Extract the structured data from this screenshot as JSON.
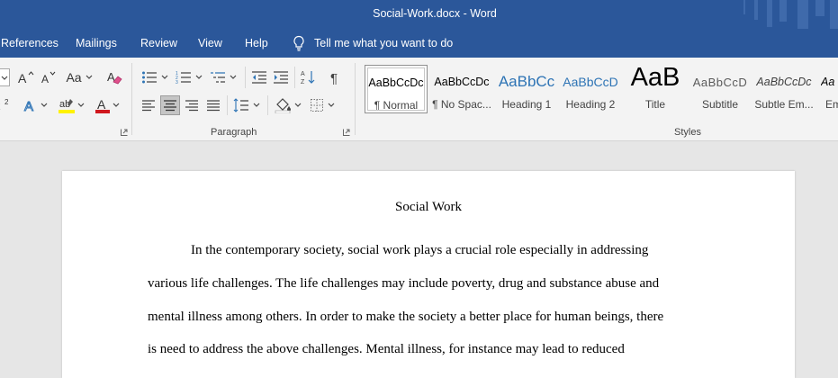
{
  "window": {
    "title": "Social-Work.docx  -  Word"
  },
  "menu": {
    "tabs": [
      "References",
      "Mailings",
      "Review",
      "View",
      "Help"
    ],
    "tell_me": "Tell me what you want to do"
  },
  "ribbon": {
    "font": {
      "change_case_label": "Aa"
    },
    "groups": {
      "paragraph_label": "Paragraph",
      "styles_label": "Styles"
    },
    "styles": [
      {
        "preview": "AaBbCcDc",
        "name": "¶ Normal",
        "selected": true
      },
      {
        "preview": "AaBbCcDc",
        "name": "¶ No Spac...",
        "selected": false
      },
      {
        "preview": "AaBbCc",
        "name": "Heading 1",
        "selected": false
      },
      {
        "preview": "AaBbCcD",
        "name": "Heading 2",
        "selected": false
      },
      {
        "preview": "AaB",
        "name": "Title",
        "selected": false
      },
      {
        "preview": "AaBbCcD",
        "name": "Subtitle",
        "selected": false
      },
      {
        "preview": "AaBbCcDc",
        "name": "Subtle Em...",
        "selected": false
      },
      {
        "preview": "Aa",
        "name": "Em",
        "selected": false
      }
    ]
  },
  "document": {
    "heading": "Social Work",
    "lines": [
      "In the contemporary society, social work plays a crucial role especially in addressing",
      "various life challenges. The life challenges may include poverty, drug and substance abuse and",
      "mental illness among others. In order to make the society a better place for human beings, there",
      "is need to address the above challenges. Mental illness, for instance may lead to reduced"
    ]
  },
  "colors": {
    "title_bar": "#2b579a",
    "ribbon": "#f3f3f3",
    "canvas": "#e6e6e6",
    "page": "#ffffff",
    "font_color_accent": "#d0181e",
    "highlight_accent": "#fff200",
    "heading_style_text": "#2e74b5"
  },
  "icons": {
    "tell_me": "lightbulb-icon",
    "grow_font": "grow-font-icon",
    "shrink_font": "shrink-font-icon",
    "clear_formatting": "eraser-icon",
    "bullets": "bullets-icon",
    "numbering": "numbering-icon",
    "multilevel": "multilevel-list-icon",
    "decrease_indent": "decrease-indent-icon",
    "increase_indent": "increase-indent-icon",
    "sort": "sort-icon",
    "show_marks": "pilcrow-icon",
    "align_left": "align-left-icon",
    "align_center": "align-center-icon",
    "align_right": "align-right-icon",
    "justify": "justify-icon",
    "line_spacing": "line-spacing-icon",
    "shading": "shading-icon",
    "borders": "borders-icon",
    "superscript": "superscript-icon",
    "text_effects": "text-effects-icon",
    "highlight": "highlighter-icon",
    "font_color": "font-color-icon"
  }
}
